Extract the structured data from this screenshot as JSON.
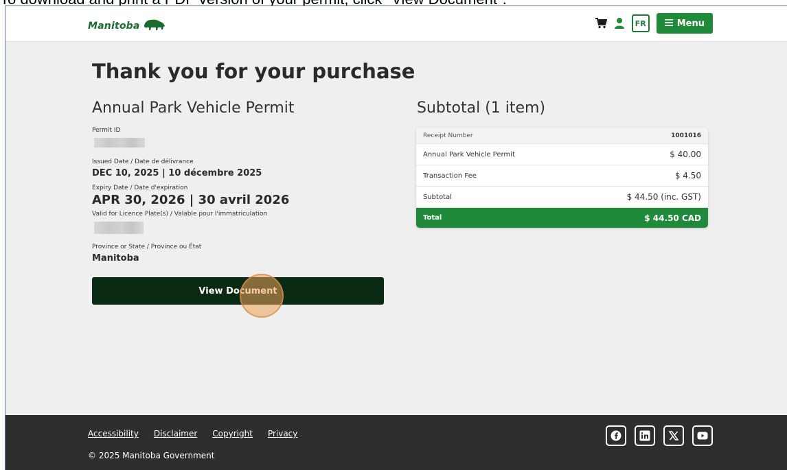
{
  "caption": "To download and print a PDF version of your permit, click \"View Document\".",
  "header": {
    "logo_text": "Manitoba",
    "lang_label": "FR",
    "menu_label": "Menu",
    "brand_color": "#1f8a3a"
  },
  "main": {
    "title": "Thank you for your purchase",
    "permit_title": "Annual Park Vehicle Permit",
    "fields": {
      "permit_id_label": "Permit ID",
      "issued_label": "Issued Date / Date de délivrance",
      "issued_value": "DEC 10, 2025 | 10 décembre 2025",
      "expiry_label": "Expiry Date / Date d'expiration",
      "expiry_value": "APR 30, 2026 | 30 avril 2026",
      "plate_label": "Valid for Licence Plate(s) / Valable pour l'immatriculation",
      "province_label": "Province or State / Province ou État",
      "province_value": "Manitoba"
    },
    "view_document_label": "View Document"
  },
  "receipt": {
    "title": "Subtotal (1 item)",
    "number_label": "Receipt Number",
    "number_value": "1001016",
    "rows": [
      {
        "label": "Annual Park Vehicle Permit",
        "value": "$ 40.00"
      },
      {
        "label": "Transaction Fee",
        "value": "$ 4.50"
      },
      {
        "label": "Subtotal",
        "value": "$ 44.50 (inc. GST)"
      }
    ],
    "total_label": "Total",
    "total_value": "$ 44.50 CAD"
  },
  "footer": {
    "links": [
      "Accessibility",
      "Disclaimer",
      "Copyright",
      "Privacy"
    ],
    "copyright": "© 2025 Manitoba Government",
    "social": [
      "facebook-icon",
      "linkedin-icon",
      "x-icon",
      "youtube-icon"
    ]
  }
}
